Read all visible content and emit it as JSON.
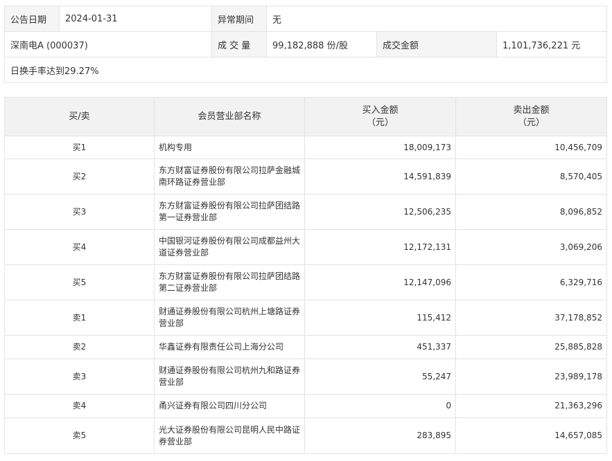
{
  "info": {
    "date_label": "公告日期",
    "date_value": "2024-01-31",
    "period_label": "异常期间",
    "period_value": "无",
    "stock": "深南电A (000037)",
    "volume_label": "成 交 量",
    "volume_value": "99,182,888 份/股",
    "amount_label": "成交金额",
    "amount_value": "1,101,736,221 元",
    "note": "日换手率达到29.27%"
  },
  "table": {
    "headers": {
      "side": "买/卖",
      "name": "会员营业部名称",
      "buy_line1": "买入金额",
      "buy_line2": "（元）",
      "sell_line1": "卖出金额",
      "sell_line2": "（元）"
    },
    "rows": [
      {
        "side": "买1",
        "name": "机构专用",
        "buy": "18,009,173",
        "sell": "10,456,709"
      },
      {
        "side": "买2",
        "name": "东方财富证券股份有限公司拉萨金融城南环路证券营业部",
        "buy": "14,591,839",
        "sell": "8,570,405"
      },
      {
        "side": "买3",
        "name": "东方财富证券股份有限公司拉萨团结路第一证券营业部",
        "buy": "12,506,235",
        "sell": "8,096,852"
      },
      {
        "side": "买4",
        "name": "中国银河证券股份有限公司成都益州大道证券营业部",
        "buy": "12,172,131",
        "sell": "3,069,206"
      },
      {
        "side": "买5",
        "name": "东方财富证券股份有限公司拉萨团结路第二证券营业部",
        "buy": "12,147,096",
        "sell": "6,329,716"
      },
      {
        "side": "卖1",
        "name": "财通证券股份有限公司杭州上塘路证券营业部",
        "buy": "115,412",
        "sell": "37,178,852"
      },
      {
        "side": "卖2",
        "name": "华鑫证券有限责任公司上海分公司",
        "buy": "451,337",
        "sell": "25,885,828"
      },
      {
        "side": "卖3",
        "name": "财通证券股份有限公司杭州九和路证券营业部",
        "buy": "55,247",
        "sell": "23,989,178"
      },
      {
        "side": "卖4",
        "name": "甬兴证券有限公司四川分公司",
        "buy": "0",
        "sell": "21,363,296"
      },
      {
        "side": "卖5",
        "name": "光大证券股份有限公司昆明人民中路证券营业部",
        "buy": "283,895",
        "sell": "14,657,085"
      }
    ]
  }
}
